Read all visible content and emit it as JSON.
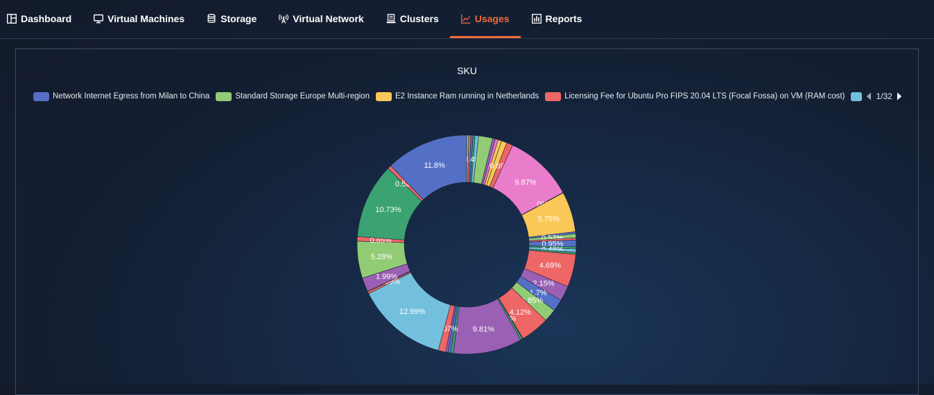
{
  "nav": {
    "items": [
      {
        "label": "Dashboard",
        "icon": "dashboard-icon",
        "active": false
      },
      {
        "label": "Virtual Machines",
        "icon": "monitor-icon",
        "active": false
      },
      {
        "label": "Storage",
        "icon": "database-icon",
        "active": false
      },
      {
        "label": "Virtual Network",
        "icon": "antenna-icon",
        "active": false
      },
      {
        "label": "Clusters",
        "icon": "cluster-icon",
        "active": false
      },
      {
        "label": "Usages",
        "icon": "line-chart-icon",
        "active": true
      },
      {
        "label": "Reports",
        "icon": "report-icon",
        "active": false
      }
    ],
    "accent": "#f06a3c"
  },
  "chart_data": {
    "type": "pie",
    "title": "SKU",
    "legend": {
      "position": "top",
      "items": [
        {
          "name": "Network Internet Egress from Milan to China",
          "color": "#5470c6"
        },
        {
          "name": "Standard Storage Europe Multi-region",
          "color": "#91cc75"
        },
        {
          "name": "E2 Instance Ram running in Netherlands",
          "color": "#fac858"
        },
        {
          "name": "Licensing Fee for Ubuntu Pro FIPS 20.04 LTS (Focal Fossa) on VM (RAM cost)",
          "color": "#ee6666"
        },
        {
          "name": "",
          "color": "#73c0de"
        }
      ],
      "page": "1/32"
    },
    "slices": [
      {
        "label": "",
        "value": 0.3,
        "color": "#91cc75"
      },
      {
        "label": "",
        "value": 0.3,
        "color": "#ee6666"
      },
      {
        "label": "",
        "value": 0.3,
        "color": "#5470c6"
      },
      {
        "label": "",
        "value": 0.3,
        "color": "#3ba272"
      },
      {
        "label": "0.49%",
        "value": 0.49,
        "color": "#73c0de"
      },
      {
        "label": "",
        "value": 2.0,
        "color": "#91cc75"
      },
      {
        "label": "",
        "value": 0.4,
        "color": "#9a60b4"
      },
      {
        "label": "",
        "value": 0.4,
        "color": "#ea7ccc"
      },
      {
        "label": "",
        "value": 0.5,
        "color": "#fac858"
      },
      {
        "label": "",
        "value": 0.8,
        "color": "#fac858"
      },
      {
        "label": "0.89%",
        "value": 0.89,
        "color": "#ee6666"
      },
      {
        "label": "9.87%",
        "value": 9.87,
        "color": "#ea7ccc"
      },
      {
        "label": "0%",
        "value": 0.0,
        "color": "#fac858"
      },
      {
        "label": "5.75%",
        "value": 5.75,
        "color": "#fac858"
      },
      {
        "label": "",
        "value": 0.3,
        "color": "#5470c6"
      },
      {
        "label": "0.57%",
        "value": 0.57,
        "color": "#91cc75"
      },
      {
        "label": "",
        "value": 0.3,
        "color": "#ee6666"
      },
      {
        "label": "0.95%",
        "value": 0.95,
        "color": "#5470c6"
      },
      {
        "label": "",
        "value": 0.3,
        "color": "#3ba272"
      },
      {
        "label": "0.48%",
        "value": 0.48,
        "color": "#73c0de"
      },
      {
        "label": "",
        "value": 0.3,
        "color": "#3ba272"
      },
      {
        "label": "4.69%",
        "value": 4.69,
        "color": "#ee6666"
      },
      {
        "label": "2.15%",
        "value": 2.15,
        "color": "#9a60b4"
      },
      {
        "label": "1.7%",
        "value": 1.7,
        "color": "#5470c6"
      },
      {
        "label": "1.85%",
        "value": 1.85,
        "color": "#91cc75"
      },
      {
        "label": "4.12%",
        "value": 4.12,
        "color": "#ee6666"
      },
      {
        "label": "0%",
        "value": 0.0,
        "color": "#3ba272"
      },
      {
        "label": "",
        "value": 0.3,
        "color": "#3ba272"
      },
      {
        "label": "9.81%",
        "value": 9.81,
        "color": "#9a60b4"
      },
      {
        "label": "",
        "value": 0.4,
        "color": "#3ba272"
      },
      {
        "label": "",
        "value": 0.4,
        "color": "#5470c6"
      },
      {
        "label": "",
        "value": 0.3,
        "color": "#9a60b4"
      },
      {
        "label": "1.07%",
        "value": 1.07,
        "color": "#ee6666"
      },
      {
        "label": "12.99%",
        "value": 12.99,
        "color": "#73c0de"
      },
      {
        "label": "",
        "value": 0.3,
        "color": "#ee6666"
      },
      {
        "label": "0.09%",
        "value": 0.09,
        "color": "#fac858"
      },
      {
        "label": "1.99%",
        "value": 1.99,
        "color": "#9a60b4"
      },
      {
        "label": "5.28%",
        "value": 5.28,
        "color": "#91cc75"
      },
      {
        "label": "0.65%",
        "value": 0.65,
        "color": "#ee6666"
      },
      {
        "label": "10.73%",
        "value": 10.73,
        "color": "#3ba272"
      },
      {
        "label": "0.52%",
        "value": 0.52,
        "color": "#ee6666"
      },
      {
        "label": "11.8%",
        "value": 11.8,
        "color": "#5470c6"
      }
    ]
  }
}
